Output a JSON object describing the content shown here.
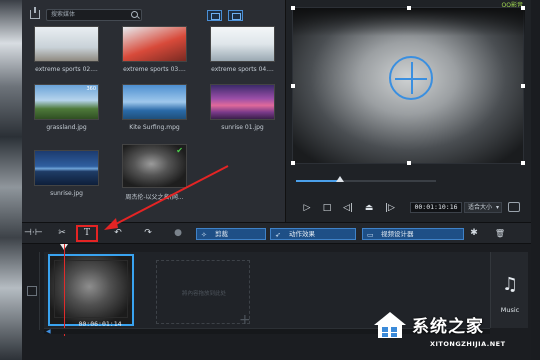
{
  "media": {
    "search_placeholder": "搜索媒体",
    "items": [
      {
        "name": "extreme sports 02...."
      },
      {
        "name": "extreme sports 03...."
      },
      {
        "name": "extreme sports 04...."
      },
      {
        "name": "grassland.jpg",
        "badge": "360"
      },
      {
        "name": "Kite Surfing.mpg"
      },
      {
        "name": "sunrise 01.jpg"
      },
      {
        "name": "sunrise.jpg"
      },
      {
        "name": "周杰伦-以父之名(网..."
      }
    ]
  },
  "preview": {
    "brand_label": "QQ影音",
    "timecode": "00:01:10:16",
    "fit_select": "适合大小",
    "controls": {
      "play": "▷",
      "stop": "□",
      "prev_frame": "◁|",
      "split": "⏏",
      "next_frame": "|▷"
    }
  },
  "toolbar": {
    "tool_labels": {
      "track_manager": "⊣·⊢",
      "cut": "✂",
      "title": "T",
      "undo": "↶",
      "redo": "↷",
      "record": "●",
      "delete": "🗑",
      "more": "✱"
    },
    "motion_label": "剪裁",
    "effect_label": "动作效果",
    "pip_label": "视频设计器"
  },
  "timeline": {
    "clip_time": "00:06:01:14",
    "drop_hint": "將內容拖放到此处",
    "music_label": "Music"
  },
  "watermark": {
    "text": "系统之家",
    "url": "XITONGZHIJIA.NET"
  },
  "colors": {
    "accent": "#3f82c8",
    "annotation": "#e42424",
    "progress": "#4ba0ea"
  }
}
